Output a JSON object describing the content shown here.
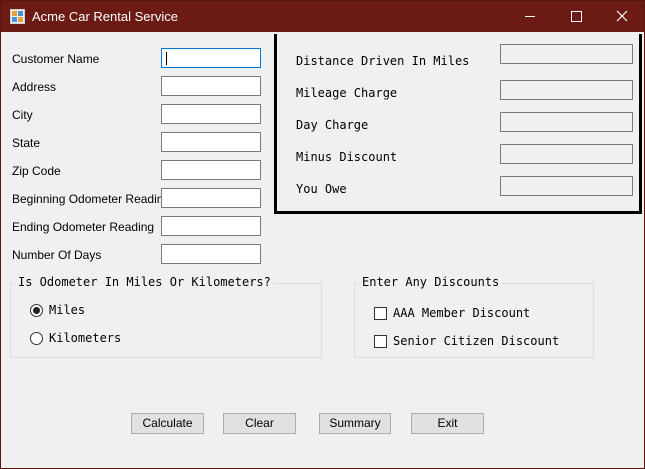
{
  "window": {
    "title": "Acme Car Rental Service",
    "icons": {
      "app": "app-form-icon",
      "minimize": "minimize-icon",
      "maximize": "maximize-icon",
      "close": "close-icon"
    }
  },
  "input_form": {
    "fields": [
      {
        "label": "Customer Name",
        "value": ""
      },
      {
        "label": "Address",
        "value": ""
      },
      {
        "label": "City",
        "value": ""
      },
      {
        "label": "State",
        "value": ""
      },
      {
        "label": "Zip Code",
        "value": ""
      },
      {
        "label": "Beginning Odometer Reading",
        "value": ""
      },
      {
        "label": "Ending Odometer Reading",
        "value": ""
      },
      {
        "label": "Number Of Days",
        "value": ""
      }
    ]
  },
  "results": {
    "rows": [
      {
        "label": "Distance Driven In Miles",
        "value": ""
      },
      {
        "label": "Mileage Charge",
        "value": ""
      },
      {
        "label": "Day Charge",
        "value": ""
      },
      {
        "label": "Minus Discount",
        "value": ""
      },
      {
        "label": "You Owe",
        "value": ""
      }
    ]
  },
  "odometer_group": {
    "title": "Is Odometer In Miles Or Kilometers?",
    "options": [
      {
        "label": "Miles",
        "selected": true
      },
      {
        "label": "Kilometers",
        "selected": false
      }
    ]
  },
  "discount_group": {
    "title": "Enter Any Discounts",
    "options": [
      {
        "label": "AAA Member Discount",
        "checked": false
      },
      {
        "label": "Senior Citizen Discount",
        "checked": false
      }
    ]
  },
  "buttons": {
    "calculate": "Calculate",
    "clear": "Clear",
    "summary": "Summary",
    "exit": "Exit"
  },
  "colors": {
    "titlebar": "#6b1b13",
    "window_bg": "#f0f0f0",
    "focus_border": "#0078d7"
  }
}
